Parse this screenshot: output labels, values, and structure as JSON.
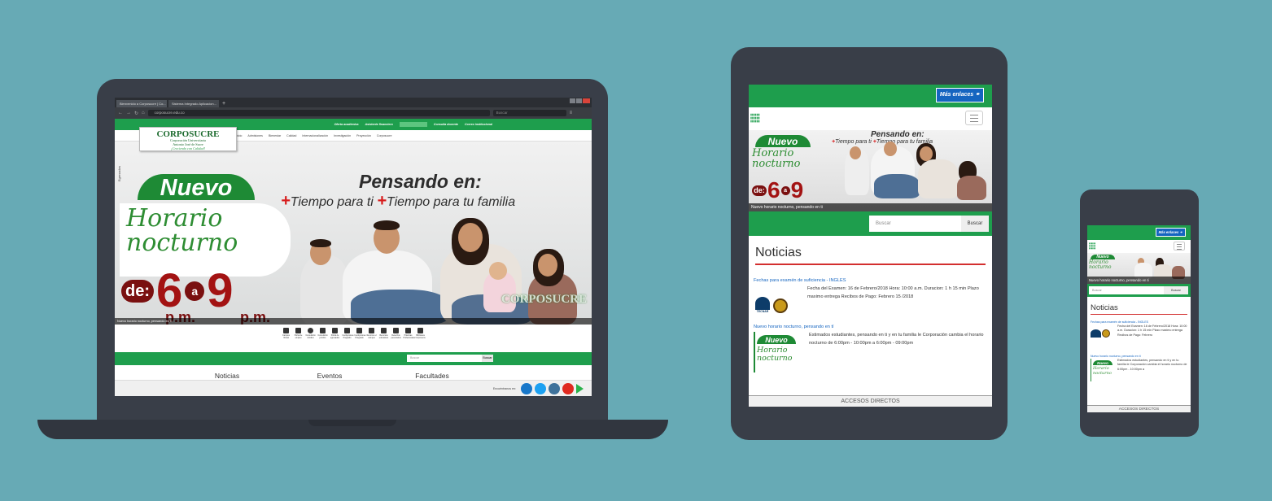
{
  "colors": {
    "background": "#67aab5",
    "device": "#393e48",
    "site_green": "#1e9e4d",
    "accent_red": "#d32f2f",
    "link_blue": "#1565c0",
    "hour_red": "#a31313"
  },
  "laptop": {
    "browser": {
      "tabs": [
        "Bienvenido a Corposucre | Co...",
        "Sistema Integrado Aplicacion..."
      ],
      "url": "corposucre.edu.co",
      "search_placeholder": "Buscar"
    },
    "top_links": [
      "Oferta académica",
      "Asistente financiero",
      "Consulta docente",
      "Correo institucional"
    ],
    "logo": {
      "name": "CORPOSUCRE",
      "line1": "Corporación Universitaria",
      "line2": "Antonio José de Sucre",
      "slogan": "¡Creciendo con Calidad!"
    },
    "menu": [
      "Inicio",
      "Admisiones",
      "Bienestar",
      "Calidad",
      "Internacionalización",
      "Investigación",
      "Proyección",
      "Corposucre"
    ],
    "side_tag": "Egresados",
    "hero": {
      "nuevo": "Nuevo",
      "horario_line1": "Horario",
      "horario_line2": "nocturno",
      "pensando": "Pensando en:",
      "tiempo1": "Tiempo para ti",
      "tiempo2": "Tiempo para tu familia",
      "de": "de:",
      "start": "6",
      "a": "a",
      "end": "9",
      "pm": "p.m.",
      "watermark": "CORPOSUCRE",
      "caption": "Nuevo horario nocturno, pensando en ti"
    },
    "quick_links": [
      {
        "icon": "laptop-icon",
        "label": "Campus Virtual"
      },
      {
        "icon": "briefcase-icon",
        "label": "Portal de empleo"
      },
      {
        "icon": "globe-icon",
        "label": "Consultorio Jurídico"
      },
      {
        "icon": "scale-icon",
        "label": "Consultorio jurídico"
      },
      {
        "icon": "graduation-cap-icon",
        "label": "Portal de egresados"
      },
      {
        "icon": "checkbox-icon",
        "label": "Inscripciones Pregrado"
      },
      {
        "icon": "check-icon",
        "label": "Inscripciones Posgrado"
      },
      {
        "icon": "video-icon",
        "label": "Recorrer el campus"
      },
      {
        "icon": "accessibility-icon",
        "label": "Recursos educativos"
      },
      {
        "icon": "id-card-icon",
        "label": "Derechos pecuniarios"
      },
      {
        "icon": "document-icon",
        "label": "Prácticas Profesionales"
      },
      {
        "icon": "book-icon",
        "label": "Biblioteca Corposucre"
      }
    ],
    "search_placeholder": "Buscar",
    "search_button": "Buscar",
    "sections": [
      "Noticias",
      "Eventos",
      "Facultades"
    ],
    "footer_label": "Encuéntranos en:"
  },
  "tablet": {
    "more_links": "Más enlaces",
    "hero": {
      "pensando": "Pensando en:",
      "tiempo1": "Tiempo para ti",
      "tiempo2": "Tiempo para tu familia",
      "nuevo": "Nuevo",
      "horario": "Horario",
      "nocturno": "nocturno",
      "de": "de:",
      "start": "6",
      "a": "a",
      "end": "9",
      "caption": "Nuevo horario nocturno, pensando en ti"
    },
    "search_placeholder": "Buscar",
    "search_button": "Buscar",
    "news_title": "Noticias",
    "news": [
      {
        "title": "Fechas para examén de suficiencia - INGLES",
        "text": "Fecha del Examen: 16 de Febrero/2018 Hora: 10:00 a.m. Duracion: 1 h 15 min Plazo maximo entrega Recibos de Pago: Febrero 15 /2018",
        "logo": "TECNAR"
      },
      {
        "title": "Nuevo horario nocturno, pensando en tí",
        "text": "Estimados estudiantes, pensando en ti y en tu familia le Corporación cambia el horario nocturno de 6:00pm - 10:00pm a 6:00pm - 09:00pm",
        "thumb_nuevo": "Nuevo",
        "thumb_horario": "Horario",
        "thumb_nocturno": "nocturno"
      }
    ],
    "accesos": "ACCESOS DIRECTOS"
  },
  "phone": {
    "more_links": "Más enlaces",
    "caption": "Nuevo horario nocturno, pensando en ti",
    "search_placeholder": "Buscar",
    "search_button": "Buscar",
    "news_title": "Noticias",
    "news": [
      {
        "title": "Fechas para examén de suficiencia - INGLES",
        "text": "Fecha del Examen: 16 de Febrero/2018 Hora: 10:00 a.m. Duracion: 1 h 15 min Plazo maximo entrega Recibos de Pago: Febrero"
      },
      {
        "title": "Nuevo horario nocturno, pensando en tí",
        "text": "Estimados estudiantes, pensando en ti y en tu familia le Corporación cambia el horario nocturno de 6:00pm - 10:00pm a"
      }
    ],
    "accesos": "ACCESOS DIRECTOS"
  }
}
